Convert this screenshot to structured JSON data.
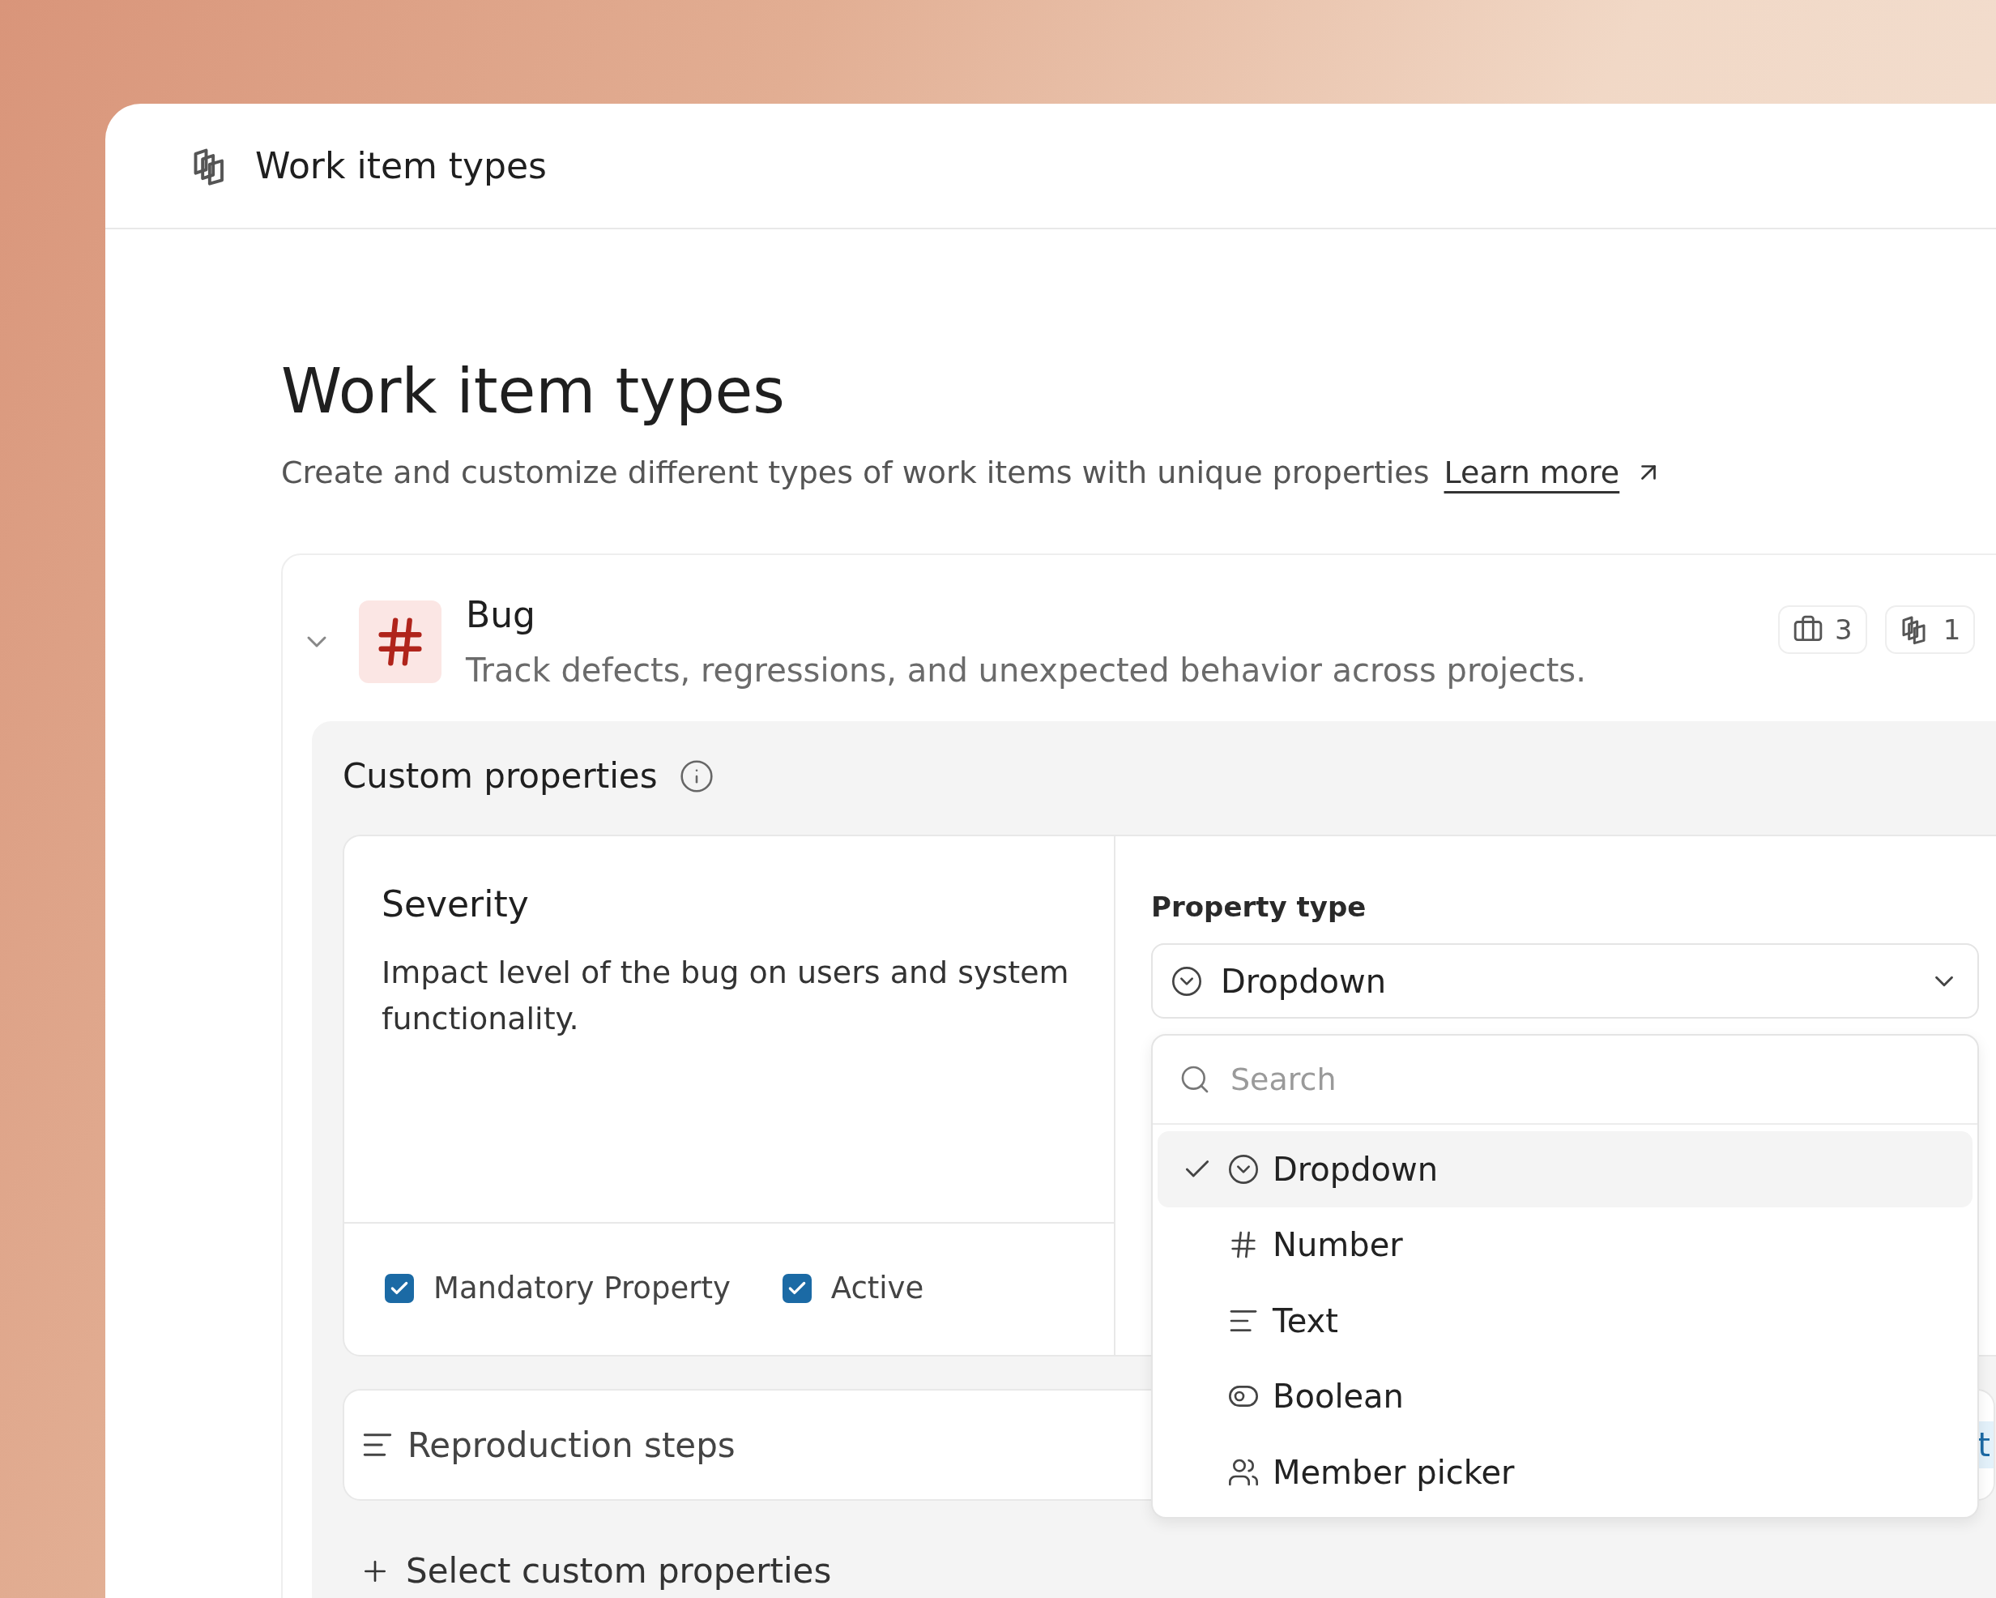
{
  "header": {
    "title": "Work item types"
  },
  "page": {
    "title": "Work item types",
    "description": "Create and customize different types of work items with unique properties",
    "learn_more": "Learn more"
  },
  "work_item_type": {
    "name": "Bug",
    "description": "Track defects, regressions, and unexpected behavior across projects.",
    "expanded": true,
    "badges": [
      {
        "kind": "projects",
        "count": "3"
      },
      {
        "kind": "types",
        "count": "1"
      }
    ],
    "custom_properties": {
      "title": "Custom properties",
      "property": {
        "name": "Severity",
        "description": "Impact level of the bug on users and system functionality.",
        "mandatory_label": "Mandatory Property",
        "mandatory": true,
        "active_label": "Active",
        "active": true,
        "type_label": "Property type",
        "type_value": "Dropdown",
        "menu": {
          "search_placeholder": "Search",
          "options": [
            {
              "kind": "dropdown",
              "label": "Dropdown",
              "selected": true
            },
            {
              "kind": "number",
              "label": "Number",
              "selected": false
            },
            {
              "kind": "text",
              "label": "Text",
              "selected": false
            },
            {
              "kind": "boolean",
              "label": "Boolean",
              "selected": false
            },
            {
              "kind": "member",
              "label": "Member picker",
              "selected": false
            }
          ]
        }
      },
      "collapsed": [
        {
          "kind": "text",
          "name": "Reproduction steps",
          "action": "t"
        }
      ],
      "add_label": "Select custom properties"
    }
  }
}
